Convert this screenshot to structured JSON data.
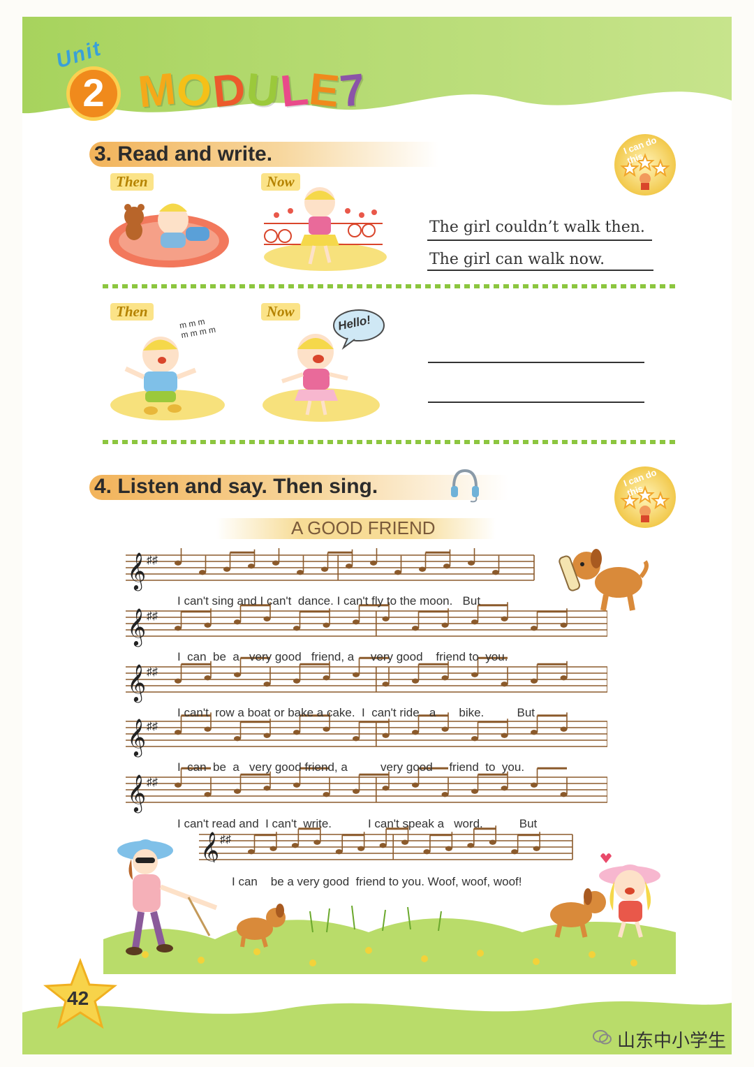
{
  "header": {
    "unit_label": "Unit",
    "unit_number": "2",
    "module_letters": [
      "M",
      "O",
      "D",
      "U",
      "L",
      "E",
      "7"
    ],
    "module_colors": [
      "#f4a91a",
      "#f5c018",
      "#ec5a2c",
      "#9bc93b",
      "#e94a8a",
      "#f08a1c",
      "#8b54a8"
    ]
  },
  "section3": {
    "title": "3. Read and write.",
    "badge_text": "I can do this",
    "row1": {
      "then_label": "Then",
      "now_label": "Now",
      "line1": "The girl couldn’t walk then.",
      "line2": "The girl can walk now."
    },
    "row2": {
      "then_label": "Then",
      "now_label": "Now",
      "mumble_text": "m m m\nm m m m",
      "speech_bubble": "Hello!"
    }
  },
  "section4": {
    "title": "4. Listen and say. Then sing.",
    "badge_text": "I can do this",
    "song_title": "A GOOD FRIEND",
    "lyrics": [
      "I can't sing and I can't  dance. I can't fly to the moon.   But",
      "I  can  be  a   very good   friend, a     very good    friend to  you.",
      "I can't  row a boat or bake a cake.  I  can't ride   a       bike.          But",
      "I  can  be  a   very good friend, a          very good     friend  to  you.",
      "I can't read and  I can't  write.           I can't speak a   word.           But",
      "I can    be a very good  friend to you. Woof, woof, woof!"
    ]
  },
  "footer": {
    "page_number": "42",
    "watermark": "山东中小学生"
  }
}
